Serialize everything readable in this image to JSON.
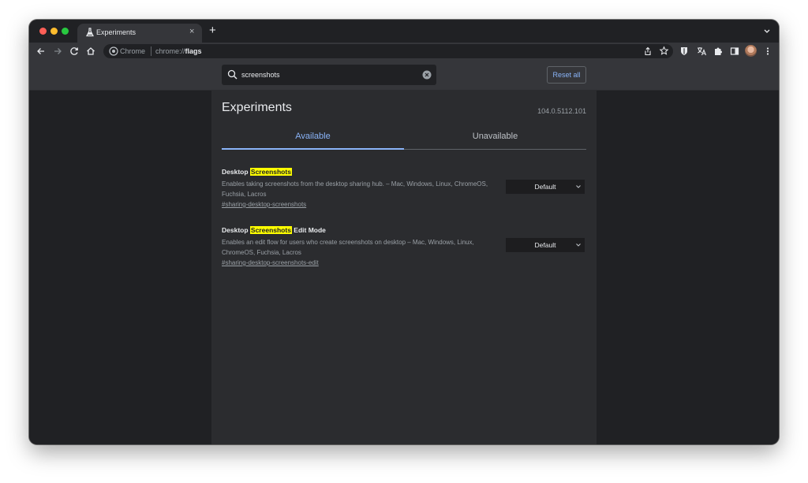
{
  "window": {
    "tab": {
      "title": "Experiments",
      "favicon": "flask-icon",
      "close_glyph": "×"
    },
    "new_tab_glyph": "+",
    "toolbar": {
      "site_label": "Chrome",
      "url_prefix": "chrome://",
      "url_path": "flags",
      "icons": [
        "back-arrow-icon",
        "forward-arrow-icon",
        "reload-icon",
        "home-icon",
        "share-icon",
        "bookmark-star-icon",
        "bitwarden-shield-icon",
        "translate-icon",
        "extensions-puzzle-icon",
        "side-panel-icon",
        "profile-avatar",
        "kebab-menu-icon"
      ]
    }
  },
  "header": {
    "search": {
      "query": "screenshots"
    },
    "reset_all_label": "Reset all"
  },
  "main": {
    "title": "Experiments",
    "version": "104.0.5112.101",
    "tabs": [
      {
        "label": "Available",
        "selected": true
      },
      {
        "label": "Unavailable",
        "selected": false
      }
    ],
    "experiments": [
      {
        "name_prefix": "Desktop ",
        "name_highlight": "Screenshots",
        "name_suffix": "",
        "description": "Enables taking screenshots from the desktop sharing hub. – Mac, Windows, Linux, ChromeOS, Fuchsia, Lacros",
        "link": "#sharing-desktop-screenshots",
        "value": "Default"
      },
      {
        "name_prefix": "Desktop ",
        "name_highlight": "Screenshots",
        "name_suffix": " Edit Mode",
        "description": "Enables an edit flow for users who create screenshots on desktop – Mac, Windows, Linux, ChromeOS, Fuchsia, Lacros",
        "link": "#sharing-desktop-screenshots-edit",
        "value": "Default"
      }
    ]
  },
  "colors": {
    "accent": "#8ab4f8",
    "highlight": "#ffff00",
    "page_bg": "#202124",
    "panel_bg": "#2b2c2f"
  }
}
